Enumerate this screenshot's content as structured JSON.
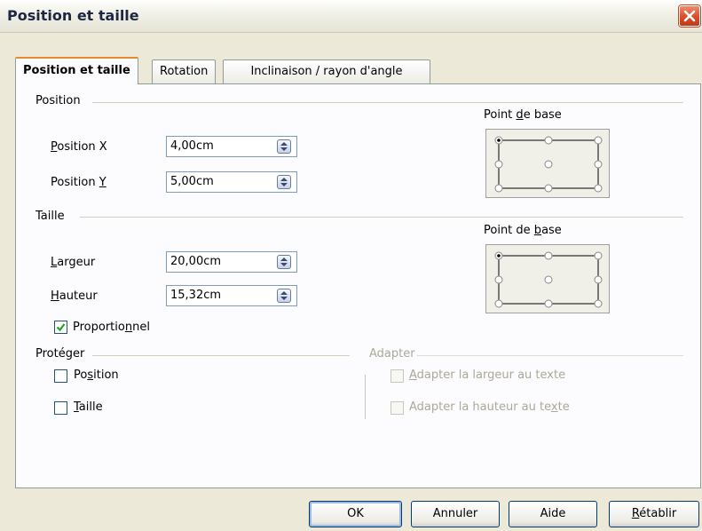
{
  "window": {
    "title": "Position et taille"
  },
  "tabs": [
    {
      "label": "Position et taille",
      "active": true
    },
    {
      "label": "Rotation",
      "active": false
    },
    {
      "label": "Inclinaison / rayon d'angle",
      "active": false
    }
  ],
  "position": {
    "section_label": "Position",
    "x_label_key": "P",
    "x_label_rest": "osition X",
    "x_value": "4,00cm",
    "y_label_pre": "Position ",
    "y_label_key": "Y",
    "y_value": "5,00cm",
    "base_label_pre": "Point ",
    "base_label_key": "d",
    "base_label_rest": "e base"
  },
  "size": {
    "section_label": "Taille",
    "width_label_key": "L",
    "width_label_rest": "argeur",
    "width_value": "20,00cm",
    "height_label_key": "H",
    "height_label_rest": "auteur",
    "height_value": "15,32cm",
    "base_label_pre": "Point de ",
    "base_label_key": "b",
    "base_label_rest": "ase",
    "proportional_pre": "Proportio",
    "proportional_key": "n",
    "proportional_rest": "nel",
    "proportional_checked": true
  },
  "protect": {
    "section_label": "Protéger",
    "position_pre": "Po",
    "position_key": "s",
    "position_rest": "ition",
    "position_checked": false,
    "size_key": "T",
    "size_rest": "aille",
    "size_checked": false
  },
  "adapt": {
    "section_label": "Adapter",
    "width_key": "A",
    "width_rest": "dapter la largeur au texte",
    "height_pre": "Adapter la hauteur au te",
    "height_key": "x",
    "height_rest": "te"
  },
  "buttons": {
    "ok": "OK",
    "cancel": "Annuler",
    "help": "Aide",
    "reset_key": "R",
    "reset_rest": "établir"
  },
  "colors": {
    "title_text": "#1d2742",
    "close_button": "#d94d28",
    "tab_highlight": "#e68b2c",
    "check_mark": "#21a121"
  }
}
